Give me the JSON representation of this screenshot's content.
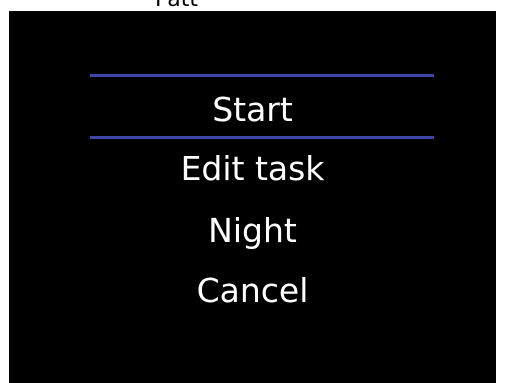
{
  "header": {
    "title_fragment": "Patt"
  },
  "menu": {
    "selected_index": 0,
    "selection_color": "#3e45a6",
    "items": [
      {
        "label": "Start"
      },
      {
        "label": "Edit task"
      },
      {
        "label": "Night"
      },
      {
        "label": "Cancel"
      }
    ]
  }
}
